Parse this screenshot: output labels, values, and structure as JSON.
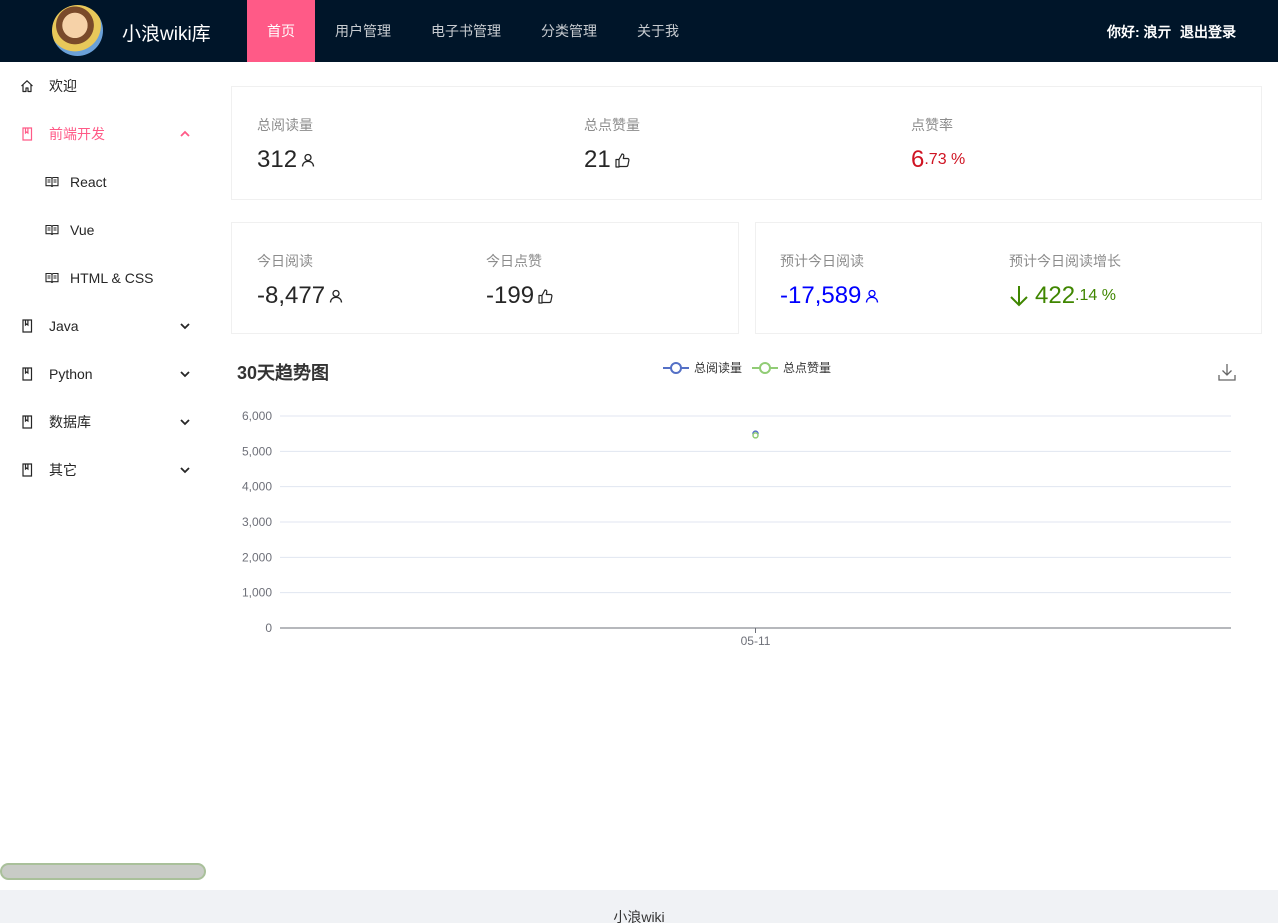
{
  "header": {
    "brand": "小浪wiki库",
    "nav": [
      "首页",
      "用户管理",
      "电子书管理",
      "分类管理",
      "关于我"
    ],
    "active_nav": 0,
    "greeting": "你好: 浪亓",
    "logout": "退出登录"
  },
  "sidebar": {
    "items": [
      {
        "label": "欢迎",
        "icon": "home-icon"
      },
      {
        "label": "前端开发",
        "icon": "book-icon",
        "open": true
      },
      {
        "label": "React",
        "icon": "read-icon",
        "sub": true
      },
      {
        "label": "Vue",
        "icon": "read-icon",
        "sub": true
      },
      {
        "label": "HTML & CSS",
        "icon": "read-icon",
        "sub": true
      },
      {
        "label": "Java",
        "icon": "book-icon"
      },
      {
        "label": "Python",
        "icon": "book-icon"
      },
      {
        "label": "数据库",
        "icon": "book-icon"
      },
      {
        "label": "其它",
        "icon": "book-icon"
      }
    ]
  },
  "stats_total": {
    "read_title": "总阅读量",
    "read_value": "312",
    "vote_title": "总点赞量",
    "vote_value": "21",
    "rate_title": "点赞率",
    "rate_int": "6",
    "rate_frac": ".73 %"
  },
  "stats_today": {
    "read_title": "今日阅读",
    "read_value": "-8,477",
    "vote_title": "今日点赞",
    "vote_value": "-199"
  },
  "stats_predict": {
    "read_title": "预计今日阅读",
    "read_value": "-17,589",
    "growth_title": "预计今日阅读增长",
    "growth_int": "422",
    "growth_frac": ".14 %"
  },
  "colors": {
    "header_bg": "#001529",
    "accent": "#ff5a87",
    "rate": "#cf1322",
    "predict": "#0000ff",
    "growth": "#3f8600",
    "series_read": "#5470c6",
    "series_vote": "#91cc75"
  },
  "chart_data": {
    "type": "line",
    "title": "30天趋势图",
    "categories": [
      "05-11"
    ],
    "series": [
      {
        "name": "总阅读量",
        "values": [
          5500
        ]
      },
      {
        "name": "总点赞量",
        "values": [
          5450
        ]
      }
    ],
    "ylim": [
      0,
      6000
    ],
    "yticks": [
      "0",
      "1,000",
      "2,000",
      "3,000",
      "4,000",
      "5,000",
      "6,000"
    ],
    "grid": true,
    "legend": "top-center"
  },
  "footer": "小浪wiki"
}
